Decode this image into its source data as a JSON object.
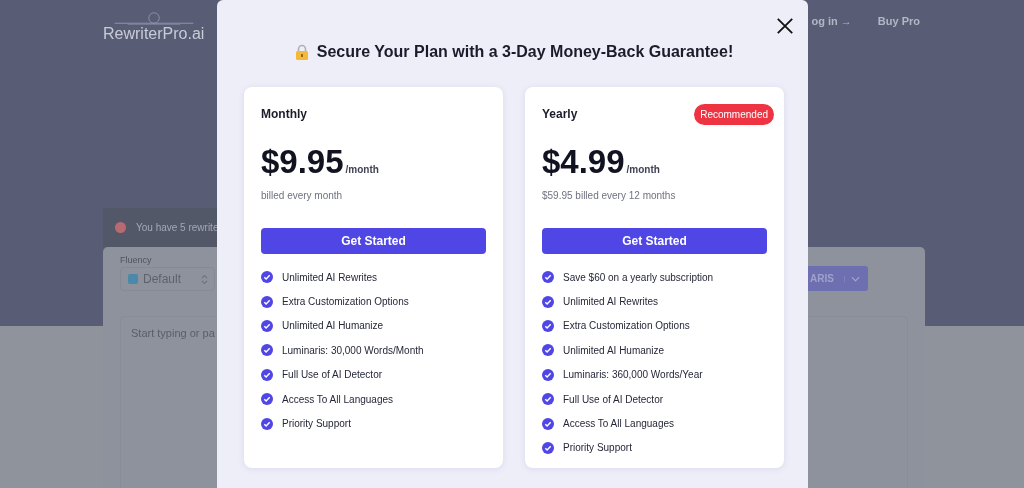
{
  "background": {
    "logo": "RewriterPro.ai",
    "nav": [
      "og in →",
      "Buy Pro"
    ],
    "alert": "You have 5 rewrite",
    "fluency_label": "Fluency",
    "mode_select": "Default",
    "editor_placeholder": "Start typing or pa",
    "model_button": "ARIS"
  },
  "modal": {
    "title": "Secure Your Plan with a 3-Day Money-Back Guarantee!",
    "plans": [
      {
        "name": "Monthly",
        "price": "$9.95",
        "period": "/month",
        "billing": "billed every month",
        "button": "Get Started",
        "features": [
          "Unlimited AI Rewrites",
          "Extra Customization Options",
          "Unlimited AI Humanize",
          "Luminaris: 30,000 Words/Month",
          "Full Use of AI Detector",
          "Access To All Languages",
          "Priority Support"
        ]
      },
      {
        "name": "Yearly",
        "price": "$4.99",
        "period": "/month",
        "billing": "$59.95 billed every 12 months",
        "badge": "Recommended",
        "button": "Get Started",
        "features": [
          "Save $60 on a yearly subscription",
          "Unlimited AI Rewrites",
          "Extra Customization Options",
          "Unlimited AI Humanize",
          "Luminaris: 360,000 Words/Year",
          "Full Use of AI Detector",
          "Access To All Languages",
          "Priority Support"
        ]
      }
    ]
  }
}
